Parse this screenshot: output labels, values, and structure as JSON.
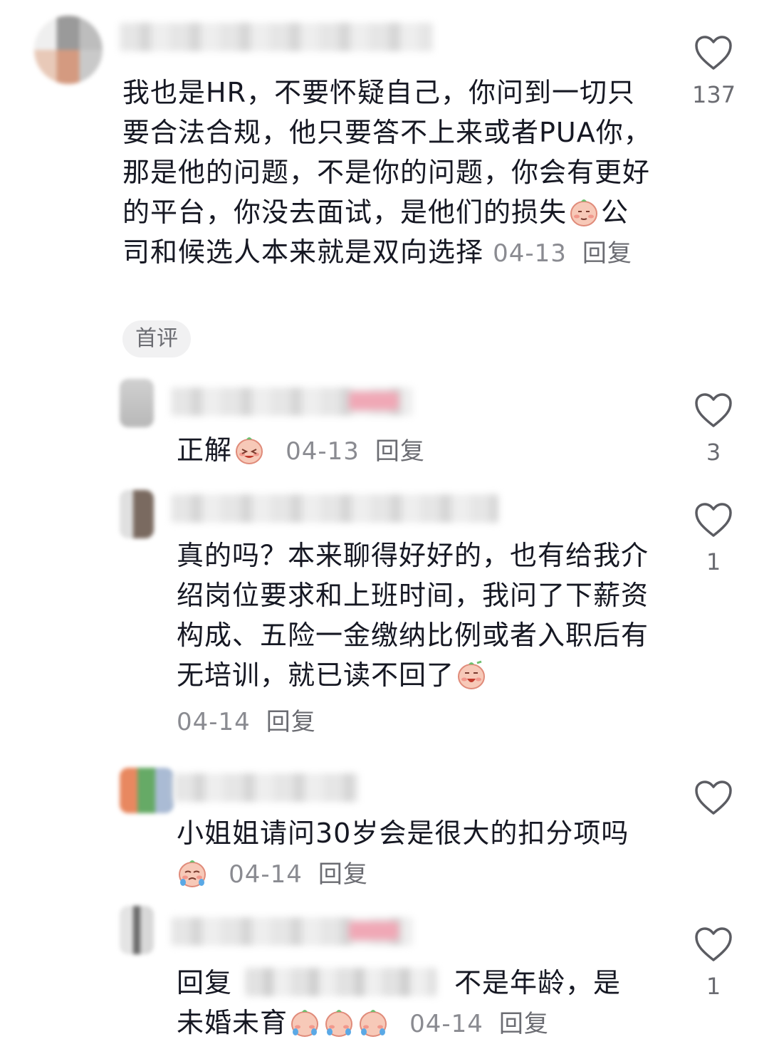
{
  "comments": [
    {
      "text_before_emoji": "我也是HR，不要怀疑自己，你问到一切只要合法合规，他只要答不上来或者PUA你，那是他的问题，不是你的问题，你会有更好的平台，你没去面试，是他们的损失",
      "text_after_emoji": "公司和候选人本来就是双向选择",
      "date": "04-13",
      "reply_label": "回复",
      "tag": "首评",
      "likes": "137",
      "emoji": "smug-face-emoji"
    },
    {
      "text": "正解",
      "date": "04-13",
      "reply_label": "回复",
      "likes": "3",
      "emoji": "laughing-face-emoji"
    },
    {
      "text": "真的吗？本来聊得好好的，也有给我介绍岗位要求和上班时间，我问了下薪资构成、五险一金缴纳比例或者入职后有无培训，就已读不回了",
      "date": "04-14",
      "reply_label": "回复",
      "likes": "1",
      "emoji": "crying-face-emoji"
    },
    {
      "text": "小姐姐请问30岁会是很大的扣分项吗",
      "date": "04-14",
      "reply_label": "回复",
      "likes": "",
      "emoji": "sobbing-face-emoji"
    },
    {
      "reply_prefix": "回复",
      "text_after_name": "不是年龄，是",
      "text_line2": "未婚未育",
      "date": "04-14",
      "reply_label": "回复",
      "likes": "1",
      "emoji": "sobbing-face-emoji"
    }
  ],
  "colors": {
    "text": "#161823",
    "meta": "#8a8b91",
    "accent_pink": "#f0a8b6"
  }
}
